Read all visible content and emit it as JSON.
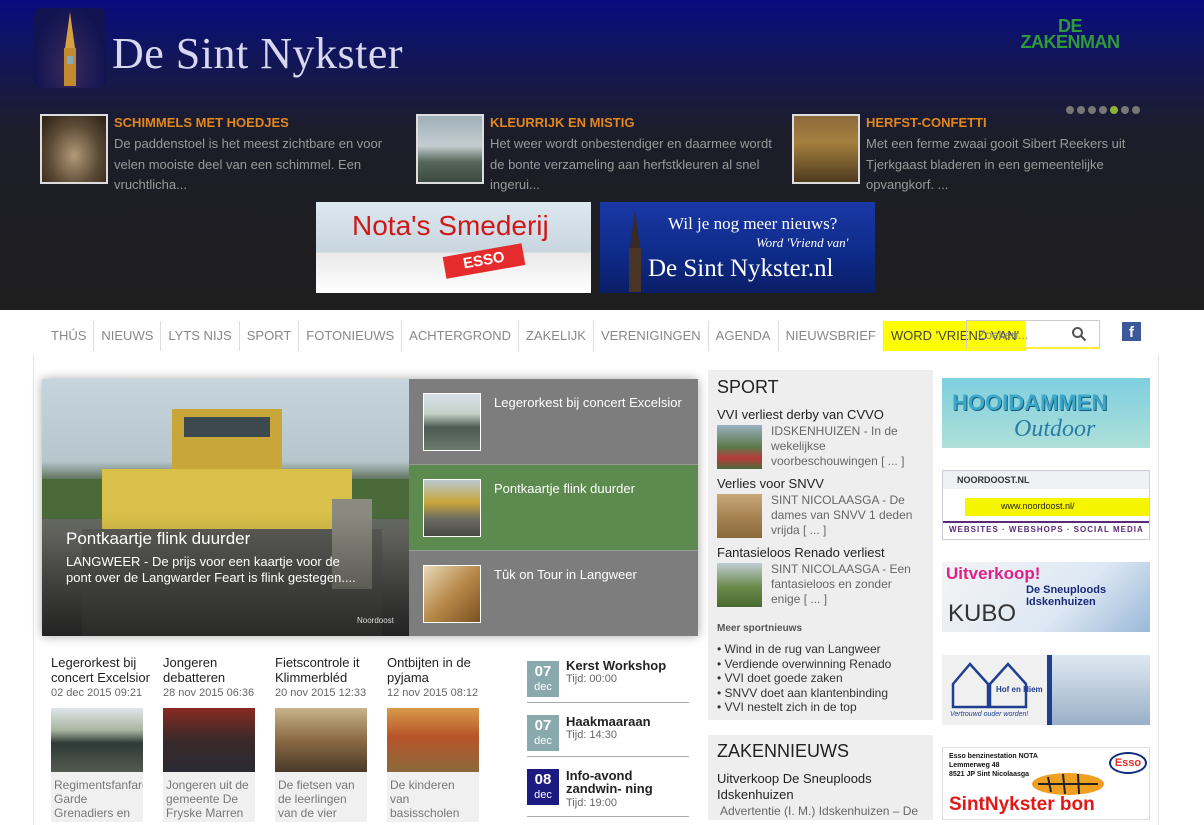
{
  "header": {
    "site_title": "De Sint Nykster",
    "partner_logo": "DE ZAKENMAN",
    "carousel_dots": 7,
    "carousel_active_index": 2,
    "featured": [
      {
        "title": "SCHIMMELS MET HOEDJES",
        "text": "De paddenstoel is het meest zichtbare en voor velen mooiste deel van een schimmel. Een vruchtlicha..."
      },
      {
        "title": "KLEURRIJK EN MISTIG",
        "text": "Het weer wordt onbestendiger en daarmee wordt de bonte verzameling aan herfstkleuren al snel ingerui..."
      },
      {
        "title": "HERFST-CONFETTI",
        "text": "Met een ferme zwaai gooit Sibert Reekers uit Tjerkgaast bladeren in een gemeentelijke opvangkorf. ..."
      }
    ],
    "banner_left": {
      "title": "Nota's Smederij",
      "brand": "ESSO"
    },
    "banner_right": {
      "line1": "Wil je nog meer nieuws?",
      "line2": "Word 'Vriend van'",
      "line3": "De Sint Nykster.nl"
    }
  },
  "nav": {
    "items": [
      "THÚS",
      "NIEUWS",
      "LYTS NIJS",
      "SPORT",
      "FOTONIEUWS",
      "ACHTERGROND",
      "ZAKELIJK",
      "VERENIGINGEN",
      "AGENDA",
      "NIEUWSBRIEF"
    ],
    "highlight": "WORD 'VRIEND VAN'",
    "search_placeholder": "Zoeken...",
    "facebook_icon": "f"
  },
  "slider": {
    "main_title": "Pontkaartje flink duurder",
    "main_text": "LANGWEER - De prijs voor een kaartje voor de pont over de Langwarder Feart is flink gestegen....",
    "photo_credit": "Noordoost",
    "items": [
      {
        "title": "Legerorkest bij concert Excelsior"
      },
      {
        "title": "Pontkaartje flink duurder"
      },
      {
        "title": "Tûk on Tour in Langweer"
      }
    ],
    "active_index": 1
  },
  "news": [
    {
      "title": "Legerorkest bij concert Excelsior",
      "date": "02 dec 2015 09:21",
      "excerpt": "Regimentsfanfare Garde Grenadiers en Jagers [ ... ]"
    },
    {
      "title": "Jongeren debatteren",
      "date": "28 nov 2015 06:36",
      "excerpt": "Jongeren uit de gemeente De Fryske Marren"
    },
    {
      "title": "Fietscontrole it Klimmerbléd",
      "date": "20 nov 2015 12:33",
      "excerpt": "De fietsen van de leerlingen van de vier oudste gr [ ... ]"
    },
    {
      "title": "Ontbijten in de pyjama",
      "date": "12 nov 2015 08:12",
      "excerpt": "De kinderen van basisscholen De Beuk in Sint Nyk"
    }
  ],
  "agenda": [
    {
      "day": "07",
      "month": "dec",
      "title": "Kerst Workshop",
      "time": "Tijd: 00:00"
    },
    {
      "day": "07",
      "month": "dec",
      "title": "Haakmaaraan",
      "time": "Tijd: 14:30"
    },
    {
      "day": "08",
      "month": "dec",
      "title": "Info-avond zandwin- ning",
      "time": "Tijd: 19:00"
    }
  ],
  "sport": {
    "heading": "SPORT",
    "items": [
      {
        "title": "VVI verliest derby van CVVO",
        "text": "IDSKENHUIZEN - In de wekelijkse voorbeschouwingen  [ ... ]"
      },
      {
        "title": "Verlies voor SNVV",
        "text": "SINT NICOLAASGA - De dames van SNVV 1 deden vrijda [ ... ]"
      },
      {
        "title": "Fantasieloos Renado verliest",
        "text": "SINT NICOLAASGA - Een fantasieloos en zonder enige [ ... ]"
      }
    ],
    "more_label": "Meer sportnieuws",
    "list": [
      "Wind in de rug van Langweer",
      "Verdiende overwinning Renado",
      "VVI doet goede zaken",
      "SNVV doet aan klantenbinding",
      "VVI nestelt zich in de top"
    ]
  },
  "zakennieuws": {
    "heading": "ZAKENNIEUWS",
    "title": "Uitverkoop De Sneuploods Idskenhuizen",
    "text": "Advertentie (I. M.) Idskenhuizen – De"
  },
  "ads": [
    {
      "name": "hooidammen",
      "text": "HOOIDAMMEN",
      "sub": "Outdoor"
    },
    {
      "name": "noordoost",
      "text": "NOORDOOST.NL",
      "url": "www.noordoost.nl/",
      "footer": "WEBSITES · WEBSHOPS · SOCIAL MEDIA"
    },
    {
      "name": "uitverkoop",
      "text": "Uitverkoop!",
      "sub": "De Sneuploods Idskenhuizen",
      "brand": "KUBO"
    },
    {
      "name": "hof-en-hiem",
      "text": "Hof en Hiem",
      "sub": "Vertrouwd ouder worden!"
    },
    {
      "name": "esso-bon",
      "line1": "Esso benzinestation NOTA",
      "line2": "Lemmerweg 48",
      "line3": "8521 JP Sint Nicolaasga",
      "text": "SintNykster bon",
      "brand": "Esso"
    }
  ]
}
